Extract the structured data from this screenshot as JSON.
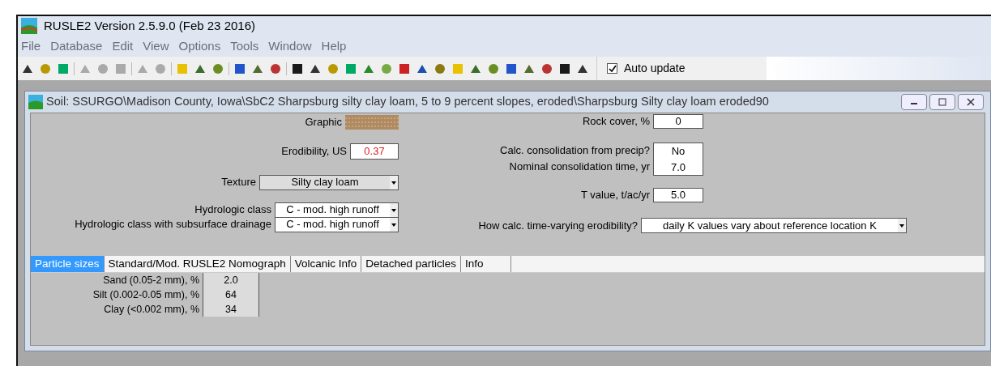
{
  "app": {
    "title": "RUSLE2 Version 2.5.9.0 (Feb 23 2016)"
  },
  "menu": [
    "File",
    "Database",
    "Edit",
    "View",
    "Options",
    "Tools",
    "Window",
    "Help"
  ],
  "toolbar": [
    [
      {
        "disabled": false
      },
      {
        "disabled": false
      },
      {
        "disabled": false
      }
    ],
    [
      {
        "disabled": true
      },
      {
        "disabled": true
      },
      {
        "disabled": true
      }
    ],
    [
      {
        "disabled": true
      },
      {
        "disabled": true
      }
    ],
    [
      {
        "disabled": false
      },
      {
        "disabled": false
      },
      {
        "disabled": false
      }
    ],
    [
      {
        "disabled": false
      },
      {
        "disabled": false
      },
      {
        "disabled": false
      }
    ],
    [
      {
        "disabled": false
      },
      {
        "disabled": false
      },
      {
        "disabled": false
      },
      {
        "disabled": false
      },
      {
        "disabled": false
      },
      {
        "disabled": false
      },
      {
        "disabled": false
      },
      {
        "disabled": false
      },
      {
        "disabled": false
      },
      {
        "disabled": false
      },
      {
        "disabled": false
      },
      {
        "disabled": false
      },
      {
        "disabled": false
      },
      {
        "disabled": false
      },
      {
        "disabled": false
      },
      {
        "disabled": false
      },
      {
        "disabled": false
      }
    ]
  ],
  "auto_update": {
    "label": "Auto update",
    "checked": true
  },
  "soil_window": {
    "title": "Soil:  SSURGO\\Madison County, Iowa\\SbC2 Sharpsburg silty clay loam, 5 to 9 percent slopes, eroded\\Sharpsburg Silty clay loam eroded90"
  },
  "graphic": {
    "label": "Graphic"
  },
  "erodibility": {
    "label": "Erodibility, US",
    "value": "0.37"
  },
  "texture": {
    "label": "Texture",
    "value": "Silty clay loam"
  },
  "hydrologic_class": {
    "label": "Hydrologic class",
    "value": "C - mod. high runoff"
  },
  "hydrologic_class_drainage": {
    "label": "Hydrologic class with subsurface drainage",
    "value": "C - mod. high runoff"
  },
  "rock_cover": {
    "label": "Rock cover, %",
    "value": "0"
  },
  "calc_consolidation": {
    "label": "Calc. consolidation from precip?",
    "value": "No"
  },
  "nominal_consolidation": {
    "label": "Nominal consolidation time, yr",
    "value": "7.0"
  },
  "t_value": {
    "label": "T value, t/ac/yr",
    "value": "5.0"
  },
  "time_varying": {
    "label": "How calc. time-varying erodibility?",
    "value": "daily K values vary about reference location K"
  },
  "tabs": [
    {
      "label": "Particle sizes",
      "selected": true
    },
    {
      "label": "Standard/Mod. RUSLE2 Nomograph",
      "selected": false
    },
    {
      "label": "Volcanic Info",
      "selected": false
    },
    {
      "label": "Detached particles",
      "selected": false
    },
    {
      "label": "Info",
      "selected": false
    }
  ],
  "particles": [
    {
      "label": "Sand (0.05-2 mm), %",
      "value": "2.0"
    },
    {
      "label": "Silt (0.002-0.05 mm), %",
      "value": "64"
    },
    {
      "label": "Clay (<0.002 mm), %",
      "value": "34"
    }
  ]
}
